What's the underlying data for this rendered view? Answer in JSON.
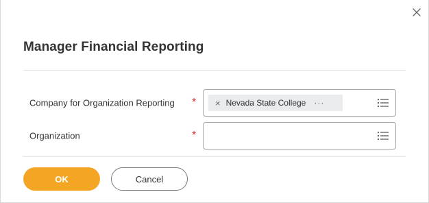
{
  "dialog": {
    "title": "Manager Financial Reporting",
    "close_icon": "close-icon"
  },
  "form": {
    "fields": [
      {
        "label": "Company for Organization Reporting",
        "required_marker": "*",
        "selected_value": "Nevada State College",
        "remove_glyph": "×",
        "more_glyph": "···",
        "prompt_icon": "list-icon"
      },
      {
        "label": "Organization",
        "required_marker": "*",
        "selected_value": "",
        "prompt_icon": "list-icon"
      }
    ]
  },
  "actions": {
    "ok_label": "OK",
    "cancel_label": "Cancel"
  },
  "colors": {
    "primary_button": "#f5a524",
    "required_marker": "#de2d2d",
    "pill_background": "#e9ebed"
  }
}
